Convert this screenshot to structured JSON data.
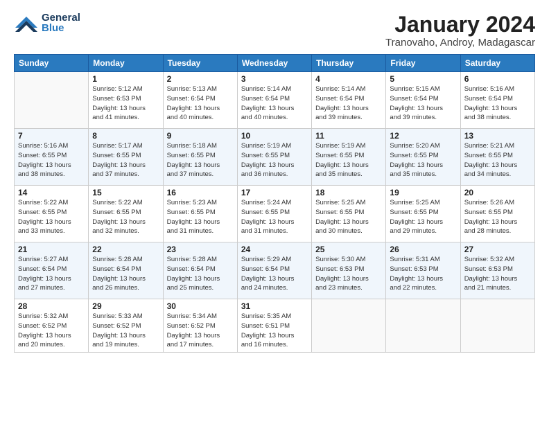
{
  "header": {
    "logo_general": "General",
    "logo_blue": "Blue",
    "title": "January 2024",
    "subtitle": "Tranovaho, Androy, Madagascar"
  },
  "days_of_week": [
    "Sunday",
    "Monday",
    "Tuesday",
    "Wednesday",
    "Thursday",
    "Friday",
    "Saturday"
  ],
  "weeks": [
    [
      {
        "day": "",
        "info": ""
      },
      {
        "day": "1",
        "info": "Sunrise: 5:12 AM\nSunset: 6:53 PM\nDaylight: 13 hours\nand 41 minutes."
      },
      {
        "day": "2",
        "info": "Sunrise: 5:13 AM\nSunset: 6:54 PM\nDaylight: 13 hours\nand 40 minutes."
      },
      {
        "day": "3",
        "info": "Sunrise: 5:14 AM\nSunset: 6:54 PM\nDaylight: 13 hours\nand 40 minutes."
      },
      {
        "day": "4",
        "info": "Sunrise: 5:14 AM\nSunset: 6:54 PM\nDaylight: 13 hours\nand 39 minutes."
      },
      {
        "day": "5",
        "info": "Sunrise: 5:15 AM\nSunset: 6:54 PM\nDaylight: 13 hours\nand 39 minutes."
      },
      {
        "day": "6",
        "info": "Sunrise: 5:16 AM\nSunset: 6:54 PM\nDaylight: 13 hours\nand 38 minutes."
      }
    ],
    [
      {
        "day": "7",
        "info": "Sunrise: 5:16 AM\nSunset: 6:55 PM\nDaylight: 13 hours\nand 38 minutes."
      },
      {
        "day": "8",
        "info": "Sunrise: 5:17 AM\nSunset: 6:55 PM\nDaylight: 13 hours\nand 37 minutes."
      },
      {
        "day": "9",
        "info": "Sunrise: 5:18 AM\nSunset: 6:55 PM\nDaylight: 13 hours\nand 37 minutes."
      },
      {
        "day": "10",
        "info": "Sunrise: 5:19 AM\nSunset: 6:55 PM\nDaylight: 13 hours\nand 36 minutes."
      },
      {
        "day": "11",
        "info": "Sunrise: 5:19 AM\nSunset: 6:55 PM\nDaylight: 13 hours\nand 35 minutes."
      },
      {
        "day": "12",
        "info": "Sunrise: 5:20 AM\nSunset: 6:55 PM\nDaylight: 13 hours\nand 35 minutes."
      },
      {
        "day": "13",
        "info": "Sunrise: 5:21 AM\nSunset: 6:55 PM\nDaylight: 13 hours\nand 34 minutes."
      }
    ],
    [
      {
        "day": "14",
        "info": "Sunrise: 5:22 AM\nSunset: 6:55 PM\nDaylight: 13 hours\nand 33 minutes."
      },
      {
        "day": "15",
        "info": "Sunrise: 5:22 AM\nSunset: 6:55 PM\nDaylight: 13 hours\nand 32 minutes."
      },
      {
        "day": "16",
        "info": "Sunrise: 5:23 AM\nSunset: 6:55 PM\nDaylight: 13 hours\nand 31 minutes."
      },
      {
        "day": "17",
        "info": "Sunrise: 5:24 AM\nSunset: 6:55 PM\nDaylight: 13 hours\nand 31 minutes."
      },
      {
        "day": "18",
        "info": "Sunrise: 5:25 AM\nSunset: 6:55 PM\nDaylight: 13 hours\nand 30 minutes."
      },
      {
        "day": "19",
        "info": "Sunrise: 5:25 AM\nSunset: 6:55 PM\nDaylight: 13 hours\nand 29 minutes."
      },
      {
        "day": "20",
        "info": "Sunrise: 5:26 AM\nSunset: 6:55 PM\nDaylight: 13 hours\nand 28 minutes."
      }
    ],
    [
      {
        "day": "21",
        "info": "Sunrise: 5:27 AM\nSunset: 6:54 PM\nDaylight: 13 hours\nand 27 minutes."
      },
      {
        "day": "22",
        "info": "Sunrise: 5:28 AM\nSunset: 6:54 PM\nDaylight: 13 hours\nand 26 minutes."
      },
      {
        "day": "23",
        "info": "Sunrise: 5:28 AM\nSunset: 6:54 PM\nDaylight: 13 hours\nand 25 minutes."
      },
      {
        "day": "24",
        "info": "Sunrise: 5:29 AM\nSunset: 6:54 PM\nDaylight: 13 hours\nand 24 minutes."
      },
      {
        "day": "25",
        "info": "Sunrise: 5:30 AM\nSunset: 6:53 PM\nDaylight: 13 hours\nand 23 minutes."
      },
      {
        "day": "26",
        "info": "Sunrise: 5:31 AM\nSunset: 6:53 PM\nDaylight: 13 hours\nand 22 minutes."
      },
      {
        "day": "27",
        "info": "Sunrise: 5:32 AM\nSunset: 6:53 PM\nDaylight: 13 hours\nand 21 minutes."
      }
    ],
    [
      {
        "day": "28",
        "info": "Sunrise: 5:32 AM\nSunset: 6:52 PM\nDaylight: 13 hours\nand 20 minutes."
      },
      {
        "day": "29",
        "info": "Sunrise: 5:33 AM\nSunset: 6:52 PM\nDaylight: 13 hours\nand 19 minutes."
      },
      {
        "day": "30",
        "info": "Sunrise: 5:34 AM\nSunset: 6:52 PM\nDaylight: 13 hours\nand 17 minutes."
      },
      {
        "day": "31",
        "info": "Sunrise: 5:35 AM\nSunset: 6:51 PM\nDaylight: 13 hours\nand 16 minutes."
      },
      {
        "day": "",
        "info": ""
      },
      {
        "day": "",
        "info": ""
      },
      {
        "day": "",
        "info": ""
      }
    ]
  ]
}
